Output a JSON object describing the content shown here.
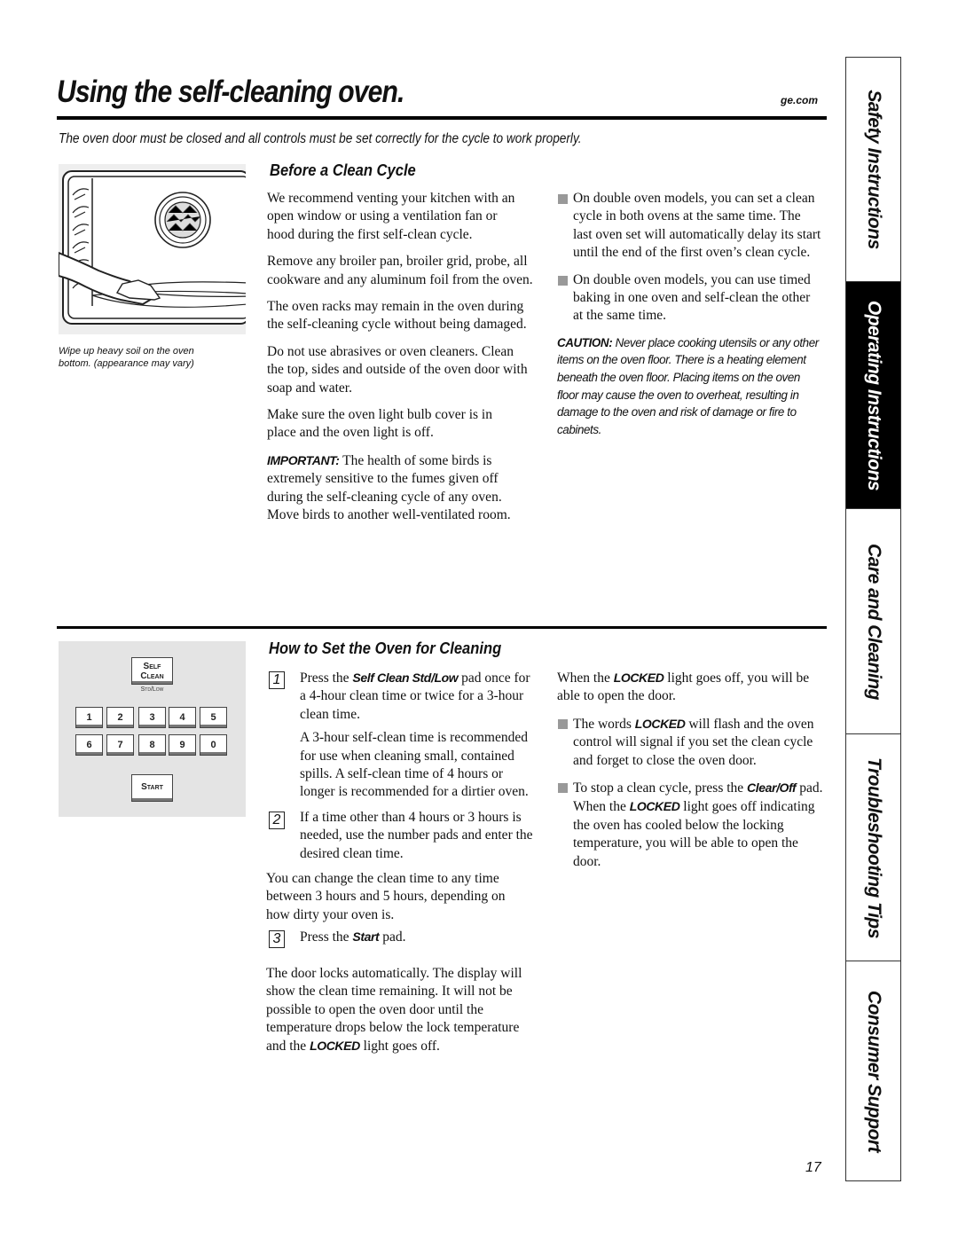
{
  "header": {
    "title": "Using the self-cleaning oven.",
    "site": "ge.com",
    "intro": "The oven door must be closed and all controls must be set correctly for the cycle to work properly."
  },
  "figure": {
    "oven_illustration": "oven-wipe-illustration",
    "caption_line1": "Wipe up heavy soil on the oven",
    "caption_line2": "bottom. (appearance may vary)"
  },
  "before_clean": {
    "heading": "Before a Clean Cycle",
    "paragraphs": [
      "We recommend venting your kitchen with an open window or using a ventilation fan or hood during the first self-clean cycle.",
      "Remove any broiler pan, broiler grid, probe, all cookware and any aluminum foil from the oven.",
      "The oven racks may remain in the oven during the self-cleaning cycle without being damaged.",
      "Do not use abrasives or oven cleaners. Clean the top, sides and outside of the oven door with soap and water.",
      "Make sure the oven light bulb cover is in place and the oven light is off."
    ],
    "important_label": "IMPORTANT:",
    "important_text": " The health of some birds is extremely sensitive to the fumes given off during the self-cleaning cycle of any oven. Move birds to another well-ventilated room.",
    "bullets": [
      "On double oven models, you can set a clean cycle in both ovens at the same time. The last oven set will automatically delay its start until the end of the first oven’s clean cycle.",
      "On double oven models, you can use timed baking in one oven and self-clean the other at the same time."
    ],
    "caution_label": "CAUTION:",
    "caution_text": " Never place cooking utensils or any other items on the oven floor. There is a heating element beneath the oven floor. Placing items on the oven floor may cause the oven to overheat, resulting in damage to the oven and risk of damage or fire to cabinets."
  },
  "control_panel": {
    "self_clean_line1": "Self",
    "self_clean_line2": "Clean",
    "std_low": "Std/Low",
    "number_keys": [
      "1",
      "2",
      "3",
      "4",
      "5",
      "6",
      "7",
      "8",
      "9",
      "0"
    ],
    "start": "Start"
  },
  "how_to": {
    "heading": "How to Set the Oven for Cleaning",
    "step1_num": "1",
    "step1_pre": "Press the ",
    "step1_bold": "Self Clean Std/Low",
    "step1_post": " pad once for a 4-hour clean time or twice for a 3-hour clean time.",
    "step1_note": "A 3-hour self-clean time is recommended for use when cleaning small, contained spills. A self-clean time of 4 hours or longer is recommended for a dirtier oven.",
    "step2_num": "2",
    "step2_text": "If a time other than 4 hours or 3 hours is needed, use the number pads and enter the desired clean time.",
    "change_time": "You can change the clean time to any time between 3 hours and 5 hours, depending on how dirty your oven is.",
    "step3_num": "3",
    "step3_pre": "Press the ",
    "step3_bold": "Start",
    "step3_post": " pad.",
    "door_locks_pre": "The door locks automatically. The display will show the clean time remaining. It will not be possible to open the oven door until the temperature drops below the lock temperature and the ",
    "door_locks_bold": "LOCKED",
    "door_locks_post": " light goes off.",
    "when_pre": "When the ",
    "when_bold": "LOCKED",
    "when_post": " light goes off, you will be able to open the door.",
    "bullet1_pre": "The words ",
    "bullet1_bold": "LOCKED",
    "bullet1_post": " will flash and the oven control will signal if you set the clean cycle and forget to close the oven door.",
    "bullet2_pre": "To stop a clean cycle, press the ",
    "bullet2_bold1": "Clear/Off",
    "bullet2_mid": " pad. When the ",
    "bullet2_bold2": "LOCKED",
    "bullet2_post": " light goes off indicating the oven has cooled below the locking temperature, you will be able to open the door."
  },
  "side_tabs": [
    {
      "label": "Safety Instructions",
      "active": false
    },
    {
      "label": "Operating Instructions",
      "active": true
    },
    {
      "label": "Care and Cleaning",
      "active": false
    },
    {
      "label": "Troubleshooting Tips",
      "active": false
    },
    {
      "label": "Consumer Support",
      "active": false
    }
  ],
  "page_number": "17"
}
